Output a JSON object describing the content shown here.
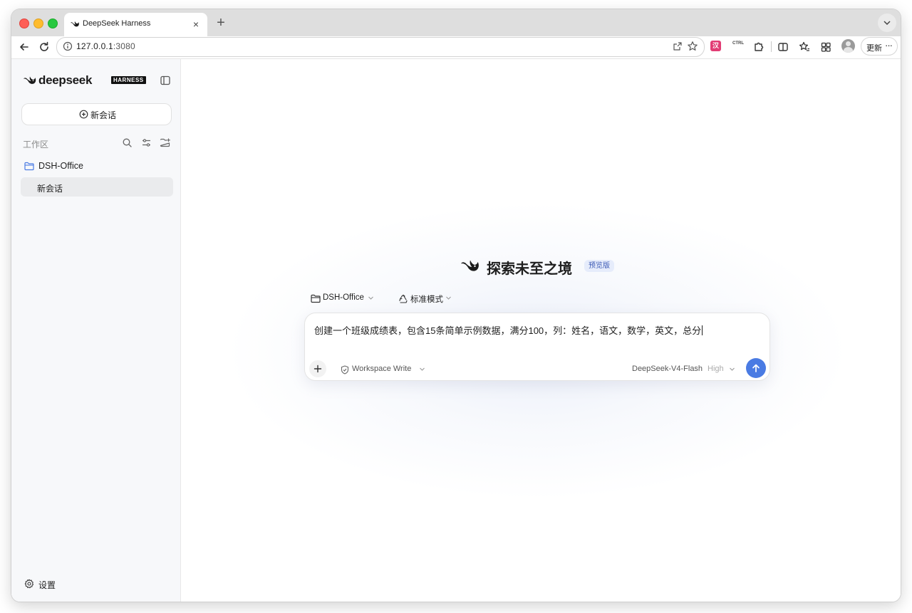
{
  "browser": {
    "tab_title": "DeepSeek Harness",
    "tab_close": "×",
    "new_tab": "+",
    "url_host": "127.0.0.1",
    "url_port": ":3080",
    "ext_pink_label": "汉",
    "ext_text_label": "CTRL",
    "update_label": "更新",
    "more_label": "···"
  },
  "sidebar": {
    "brand_word": "deepseek",
    "brand_badge": "HARNESS",
    "new_chat_label": "新会话",
    "workspace_label": "工作区",
    "folder_name": "DSH-Office",
    "conversations": [
      {
        "title": "新会话"
      }
    ],
    "settings_label": "设置"
  },
  "main": {
    "hero_title": "探索未至之境",
    "hero_badge": "预览版",
    "workspace_chip": "DSH-Office",
    "mode_chip": "标准模式",
    "composer": {
      "text": "创建一个班级成绩表，包含15条简单示例数据，满分100，列：姓名，语文，数学，英文，总分"
    },
    "permission_label": "Workspace Write",
    "model_name": "DeepSeek-V4-Flash",
    "model_effort": "High"
  },
  "colors": {
    "accent": "#4a7be3",
    "badge_bg": "#e6ecfb",
    "badge_text": "#3d5bb5",
    "sidebar_bg": "#f7f8fa",
    "selected_bg": "#eaebed"
  },
  "icons": {
    "brand": "whale-logo-icon",
    "sidebar_toggle": "sidebar-toggle-icon",
    "new_chat": "plus-circle-icon",
    "search": "search-icon",
    "filter": "sliders-icon",
    "new_folder": "folder-plus-icon",
    "folder": "folder-icon",
    "settings": "gear-icon",
    "mode": "recycle-icon",
    "permission": "shield-icon",
    "send": "arrow-up-icon"
  }
}
